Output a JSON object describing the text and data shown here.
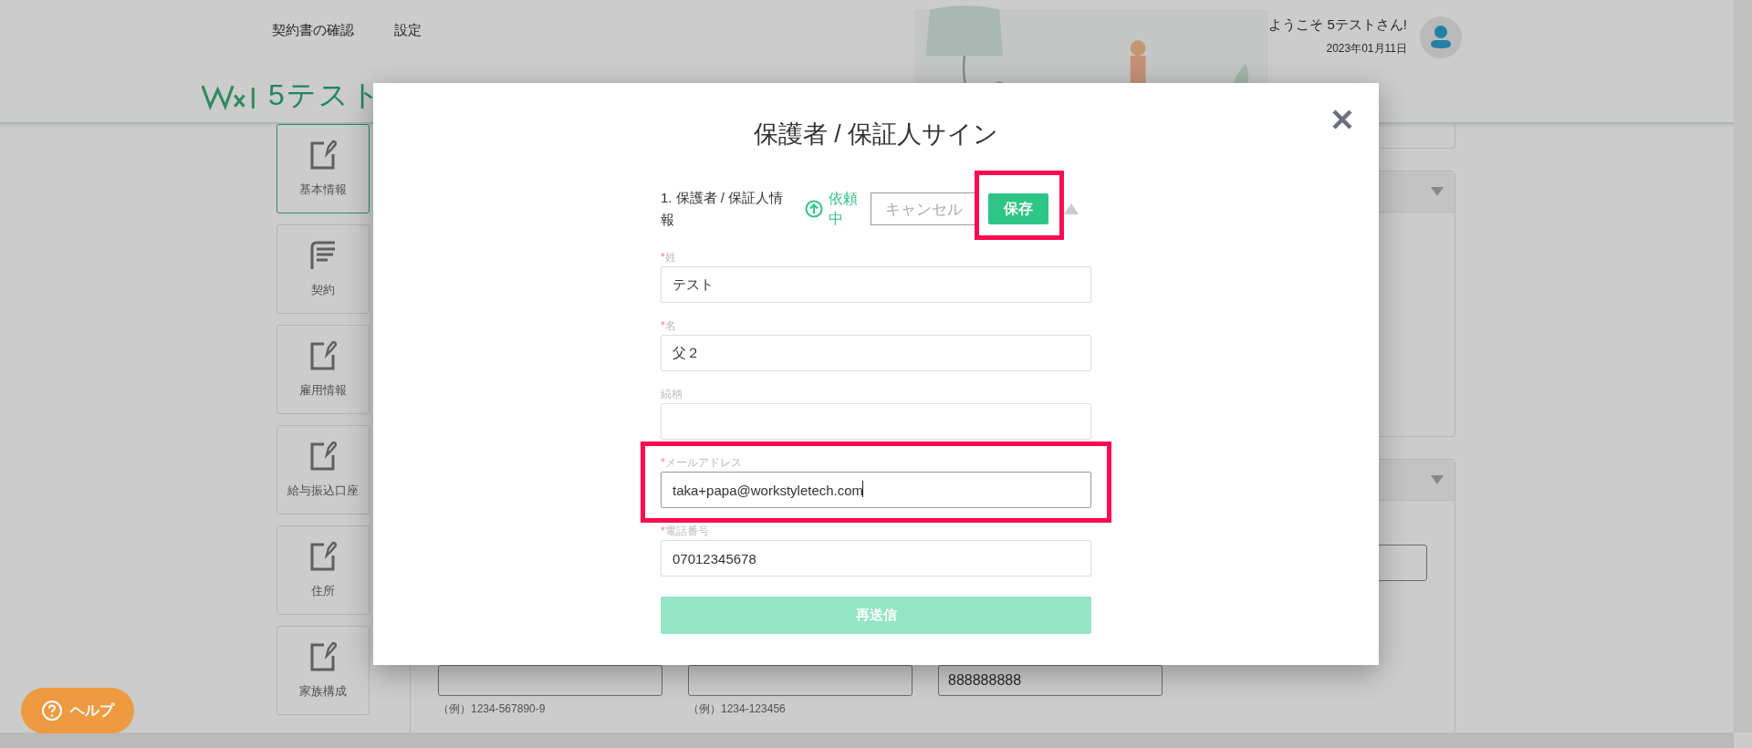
{
  "header": {
    "nav": [
      {
        "label": "契約書の確認"
      },
      {
        "label": "設定"
      }
    ],
    "logo_text": "5テスト",
    "greeting": "ようこそ 5テストさん!",
    "date": "2023年01月11日"
  },
  "sidebar": {
    "items": [
      {
        "label": "基本情報",
        "kind": "edit",
        "selected": true
      },
      {
        "label": "契約",
        "kind": "list",
        "selected": false
      },
      {
        "label": "雇用情報",
        "kind": "edit",
        "selected": false
      },
      {
        "label": "給与振込口座",
        "kind": "edit",
        "selected": false
      },
      {
        "label": "住所",
        "kind": "edit",
        "selected": false
      },
      {
        "label": "家族構成",
        "kind": "edit",
        "selected": false
      }
    ]
  },
  "background_form": {
    "fields": [
      {
        "hint": "（例）1234-567890-9"
      },
      {
        "hint": "（例）1234-123456"
      },
      {
        "value": "888888888"
      }
    ]
  },
  "help_button": {
    "label": "ヘルプ"
  },
  "modal": {
    "title": "保護者 / 保証人サイン",
    "required_mark": "*",
    "section": {
      "title": "1. 保護者 / 保証人情報",
      "status": "依頼中",
      "cancel": "キャンセル",
      "save": {
        "label": "保存",
        "highlighted": true
      },
      "expanded": true
    },
    "fields": [
      {
        "label": "姓",
        "required": true,
        "value": "テスト",
        "highlighted": false,
        "focused": false
      },
      {
        "label": "名",
        "required": true,
        "value": "父２",
        "highlighted": false,
        "focused": false
      },
      {
        "label": "続柄",
        "required": false,
        "highlighted": false,
        "focused": false
      },
      {
        "label": "メールアドレス",
        "required": true,
        "value": "taka+papa@workstyletech.com",
        "highlighted": true,
        "focused": true
      },
      {
        "label": "電話番号",
        "required": true,
        "value": "07012345678",
        "highlighted": false,
        "focused": false
      }
    ],
    "resend_button": {
      "label": "再送信",
      "disabled": true
    }
  }
}
